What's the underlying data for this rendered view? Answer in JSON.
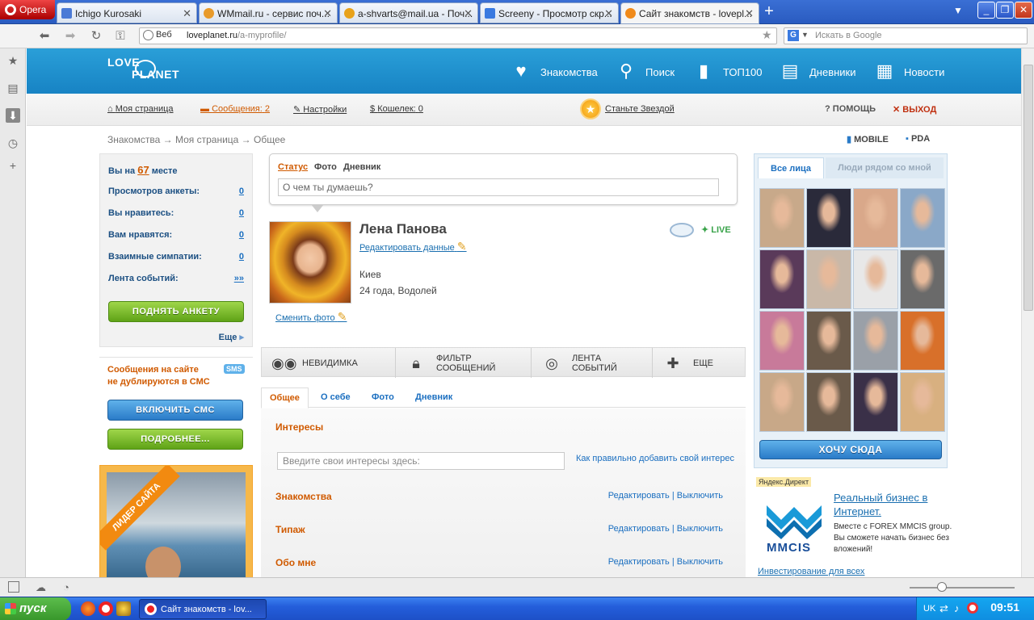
{
  "browser": {
    "menu_label": "Opera",
    "tabs": [
      {
        "label": "Ichigo Kurosaki",
        "icon": "video-icon",
        "color": "#4a7ad6"
      },
      {
        "label": "WMmail.ru - сервис поч...",
        "icon": "wmmail-icon",
        "color": "#e89a2a"
      },
      {
        "label": "a-shvarts@mail.ua - Поч...",
        "icon": "mail-icon",
        "color": "#e8a21a"
      },
      {
        "label": "Screeny - Просмотр скр...",
        "icon": "screeny-icon",
        "color": "#3a7ae0"
      },
      {
        "label": "Сайт знакомств - lovepl...",
        "icon": "heart-icon",
        "color": "#f08a1a"
      }
    ],
    "address": {
      "security_chip": "Веб",
      "url_host": "loveplanet.ru",
      "url_path": "/a-myprofile/"
    },
    "search": {
      "placeholder": "Искать в Google",
      "engine": "G"
    }
  },
  "site": {
    "logo_line1": "LOVE",
    "logo_line2": "PLANET",
    "nav": [
      {
        "label": "Знакомства",
        "icon": "heart-plus-icon"
      },
      {
        "label": "Поиск",
        "icon": "magnifier-icon"
      },
      {
        "label": "ТОП100",
        "icon": "bars-icon"
      },
      {
        "label": "Дневники",
        "icon": "notebook-icon"
      },
      {
        "label": "Новости",
        "icon": "newspaper-icon"
      }
    ],
    "subnav": {
      "my_page": "Моя страница",
      "messages_label": "Сообщения:",
      "messages_count": "2",
      "settings": "Настройки",
      "wallet_label": "Кошелек:",
      "wallet_value": "0",
      "become_star": "Станьте Звездой",
      "help": "ПОМОЩЬ",
      "logout": "ВЫХОД"
    },
    "breadcrumb": {
      "item1": "Знакомства",
      "item2": "Моя страница",
      "item3": "Общее",
      "sep": "→"
    },
    "mobile": "MOBILE",
    "pda": "PDA"
  },
  "stats": {
    "place_prefix": "Вы на",
    "place_value": "67",
    "place_suffix": "месте",
    "rows": [
      {
        "label": "Просмотров анкеты:",
        "value": "0"
      },
      {
        "label": "Вы нравитесь:",
        "value": "0"
      },
      {
        "label": "Вам нравятся:",
        "value": "0"
      },
      {
        "label": "Взаимные симпатии:",
        "value": "0"
      },
      {
        "label": "Лента событий:",
        "value": "»»"
      }
    ],
    "raise_button": "ПОДНЯТЬ АНКЕТУ",
    "more": "Еще"
  },
  "sms": {
    "text_line1": "Сообщения на сайте",
    "text_line2": "не дублируются в СМС",
    "badge": "SMS",
    "enable_button": "ВКЛЮЧИТЬ СМС",
    "details_button": "ПОДРОБНЕЕ..."
  },
  "leader": {
    "ribbon": "ЛИДЕР САЙТА"
  },
  "status_box": {
    "tab_status": "Статус",
    "tab_photo": "Фото",
    "tab_diary": "Дневник",
    "placeholder": "О чем ты думаешь?"
  },
  "profile": {
    "name": "Лена Панова",
    "edit_link": "Редактировать данные",
    "city": "Киев",
    "age_sign": "24 года, Водолей",
    "change_photo": "Сменить фото",
    "live_badge": "LIVE"
  },
  "actions": [
    {
      "label": "НЕВИДИМКА",
      "icon": "sunglasses-icon"
    },
    {
      "label": "ФИЛЬТР СООБЩЕНИЙ",
      "icon": "lock-icon"
    },
    {
      "label": "ЛЕНТА СОБЫТИЙ",
      "icon": "record-icon"
    },
    {
      "label": "ЕЩЕ",
      "icon": "plus-icon"
    }
  ],
  "profile_tabs": [
    "Общее",
    "О себе",
    "Фото",
    "Дневник"
  ],
  "sections": {
    "interests": "Интересы",
    "interests_placeholder": "Введите свои интересы здесь:",
    "interests_help": "Как правильно добавить свой интерес",
    "edit": "Редактировать",
    "sep": "|",
    "disable": "Выключить",
    "acquaintance": "Знакомства",
    "type": "Типаж",
    "about": "Обо мне"
  },
  "faces": {
    "tab_all": "Все лица",
    "tab_near": "Люди рядом со мной",
    "want_button": "ХОЧУ СЮДА",
    "photo_tints": [
      "#c8a98a",
      "#2a2a3a",
      "#d9a88a",
      "#8aa8c8",
      "#5a3a5a",
      "#c9b8a8",
      "#e8e8e8",
      "#6a6a6a",
      "#c87a9a",
      "#6a5a4a",
      "#9aa0a8",
      "#d8702a",
      "#c8a888",
      "#6a5a4a",
      "#3a3048",
      "#d8b080"
    ]
  },
  "ad": {
    "label": "Яндекс.Директ",
    "title": "Реальный бизнес в Интернет.",
    "body": "Вместе с FOREX MMCIS group. Вы сможете начать бизнес без вложений!",
    "logo_text": "MMCIS",
    "footer": "Инвестирование для всех"
  },
  "taskbar": {
    "start": "пуск",
    "window": "Сайт знакомств - lov...",
    "lang": "UK",
    "clock": "09:51"
  },
  "colors": {
    "site_blue": "#1783c4",
    "accent_orange": "#d05a00",
    "link_blue": "#1b6fc0",
    "green_button": "#5fa317"
  }
}
